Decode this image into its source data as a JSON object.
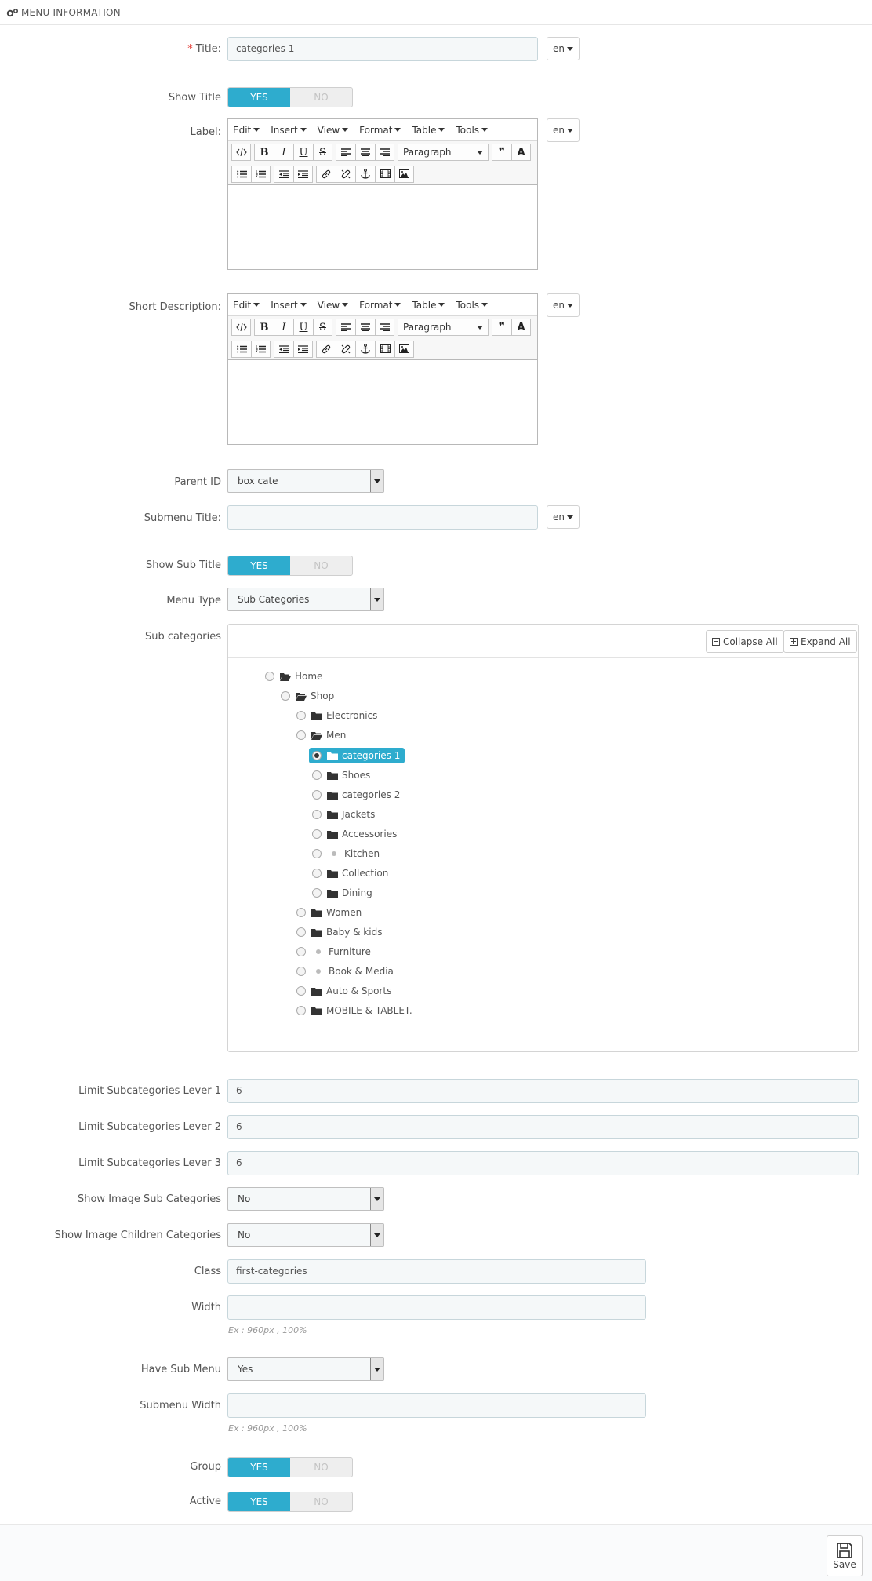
{
  "panel": {
    "title": "MENU INFORMATION",
    "icon": "cogs-icon"
  },
  "lang": "en",
  "fields": {
    "title": {
      "label": "Title:",
      "required_mark": "*",
      "value": "categories 1"
    },
    "show_title": {
      "label": "Show Title",
      "yes": "YES",
      "no": "NO",
      "value": "yes"
    },
    "label": {
      "label": "Label:"
    },
    "short_description": {
      "label": "Short Description:"
    },
    "parent_id": {
      "label": "Parent ID",
      "value": "box cate"
    },
    "submenu_title": {
      "label": "Submenu Title:",
      "value": ""
    },
    "show_sub_title": {
      "label": "Show Sub Title",
      "yes": "YES",
      "no": "NO",
      "value": "yes"
    },
    "menu_type": {
      "label": "Menu Type",
      "value": "Sub Categories"
    },
    "sub_categories": {
      "label": "Sub categories"
    },
    "limit1": {
      "label": "Limit Subcategories Lever 1",
      "value": "6"
    },
    "limit2": {
      "label": "Limit Subcategories Lever 2",
      "value": "6"
    },
    "limit3": {
      "label": "Limit Subcategories Lever 3",
      "value": "6"
    },
    "show_image_sub": {
      "label": "Show Image Sub Categories",
      "value": "No"
    },
    "show_image_children": {
      "label": "Show Image Children Categories",
      "value": "No"
    },
    "class": {
      "label": "Class",
      "value": "first-categories"
    },
    "width": {
      "label": "Width",
      "value": "",
      "hint": "Ex : 960px , 100%"
    },
    "have_sub_menu": {
      "label": "Have Sub Menu",
      "value": "Yes"
    },
    "submenu_width": {
      "label": "Submenu Width",
      "value": "",
      "hint": "Ex : 960px , 100%"
    },
    "group": {
      "label": "Group",
      "yes": "YES",
      "no": "NO",
      "value": "yes"
    },
    "active": {
      "label": "Active",
      "yes": "YES",
      "no": "NO",
      "value": "yes"
    }
  },
  "editor": {
    "menus": [
      "Edit",
      "Insert",
      "View",
      "Format",
      "Table",
      "Tools"
    ],
    "paragraph": "Paragraph",
    "buttons": [
      "code-icon",
      "bold-icon",
      "italic-icon",
      "underline-icon",
      "strikethrough-icon",
      "align-left-icon",
      "align-center-icon",
      "align-right-icon",
      "blockquote-icon",
      "text-color-icon",
      "bullet-list-icon",
      "numbered-list-icon",
      "outdent-icon",
      "indent-icon",
      "link-icon",
      "unlink-icon",
      "anchor-icon",
      "media-icon",
      "image-icon"
    ]
  },
  "tree": {
    "collapse_all": "Collapse All",
    "expand_all": "Expand All",
    "items": [
      {
        "label": "Home",
        "icon": "folder-open-icon",
        "checked": false
      },
      {
        "label": "Shop",
        "icon": "folder-open-icon",
        "checked": false
      },
      {
        "label": "Electronics",
        "icon": "folder-icon",
        "checked": false
      },
      {
        "label": "Men",
        "icon": "folder-open-icon",
        "checked": false
      },
      {
        "label": "categories 1",
        "icon": "folder-icon",
        "checked": true
      },
      {
        "label": "Shoes",
        "icon": "folder-icon",
        "checked": false
      },
      {
        "label": "categories 2",
        "icon": "folder-icon",
        "checked": false
      },
      {
        "label": "Jackets",
        "icon": "folder-icon",
        "checked": false
      },
      {
        "label": "Accessories",
        "icon": "folder-icon",
        "checked": false
      },
      {
        "label": "Kitchen",
        "icon": "leaf-dot",
        "checked": false
      },
      {
        "label": "Collection",
        "icon": "folder-icon",
        "checked": false
      },
      {
        "label": "Dining",
        "icon": "folder-icon",
        "checked": false
      },
      {
        "label": "Women",
        "icon": "folder-icon",
        "checked": false
      },
      {
        "label": "Baby & kids",
        "icon": "folder-icon",
        "checked": false
      },
      {
        "label": "Furniture",
        "icon": "leaf-dot",
        "checked": false
      },
      {
        "label": "Book & Media",
        "icon": "leaf-dot",
        "checked": false
      },
      {
        "label": "Auto & Sports",
        "icon": "folder-icon",
        "checked": false
      },
      {
        "label": "MOBILE & TABLET.",
        "icon": "folder-icon",
        "checked": false
      }
    ]
  },
  "footer": {
    "save_label": "Save"
  },
  "colors": {
    "accent": "#2eacce",
    "required": "#e3352e",
    "input_bg": "#f5f8f9"
  }
}
